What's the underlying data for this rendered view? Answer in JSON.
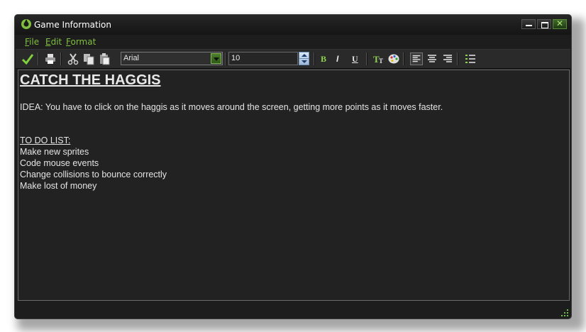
{
  "window": {
    "title": "Game Information",
    "controls": [
      "minimize-icon",
      "maximize-icon",
      "close-icon"
    ],
    "colors": {
      "accent": "#7fbf3f",
      "background": "#1d1d1d",
      "editor_background": "#222222"
    }
  },
  "menu": {
    "file_ul": "F",
    "file_rest": "ile",
    "edit_ul": "E",
    "edit_rest": "dit",
    "format_ul": "F",
    "format_rest": "ormat"
  },
  "toolbar": {
    "icons": [
      "ok-check-icon",
      "print-icon",
      "cut-icon",
      "copy-icon",
      "paste-icon",
      "bold-icon",
      "italic-icon",
      "underline-icon",
      "font-size-icon",
      "color-palette-icon",
      "align-left-icon",
      "align-center-icon",
      "align-right-icon",
      "bullet-list-icon"
    ],
    "font_name": "Arial",
    "font_size": "10",
    "bold_label": "B",
    "italic_label": "I",
    "underline_label": "U"
  },
  "document": {
    "title": "CATCH THE HAGGIS",
    "idea": "IDEA: You have to click on the haggis as it moves around the screen, getting more points as it moves faster.",
    "todo_heading": "TO DO LIST:",
    "todo_items": [
      "Make new sprites",
      "Code mouse events",
      "Change collisions to bounce correctly",
      "Make lost of money"
    ]
  }
}
